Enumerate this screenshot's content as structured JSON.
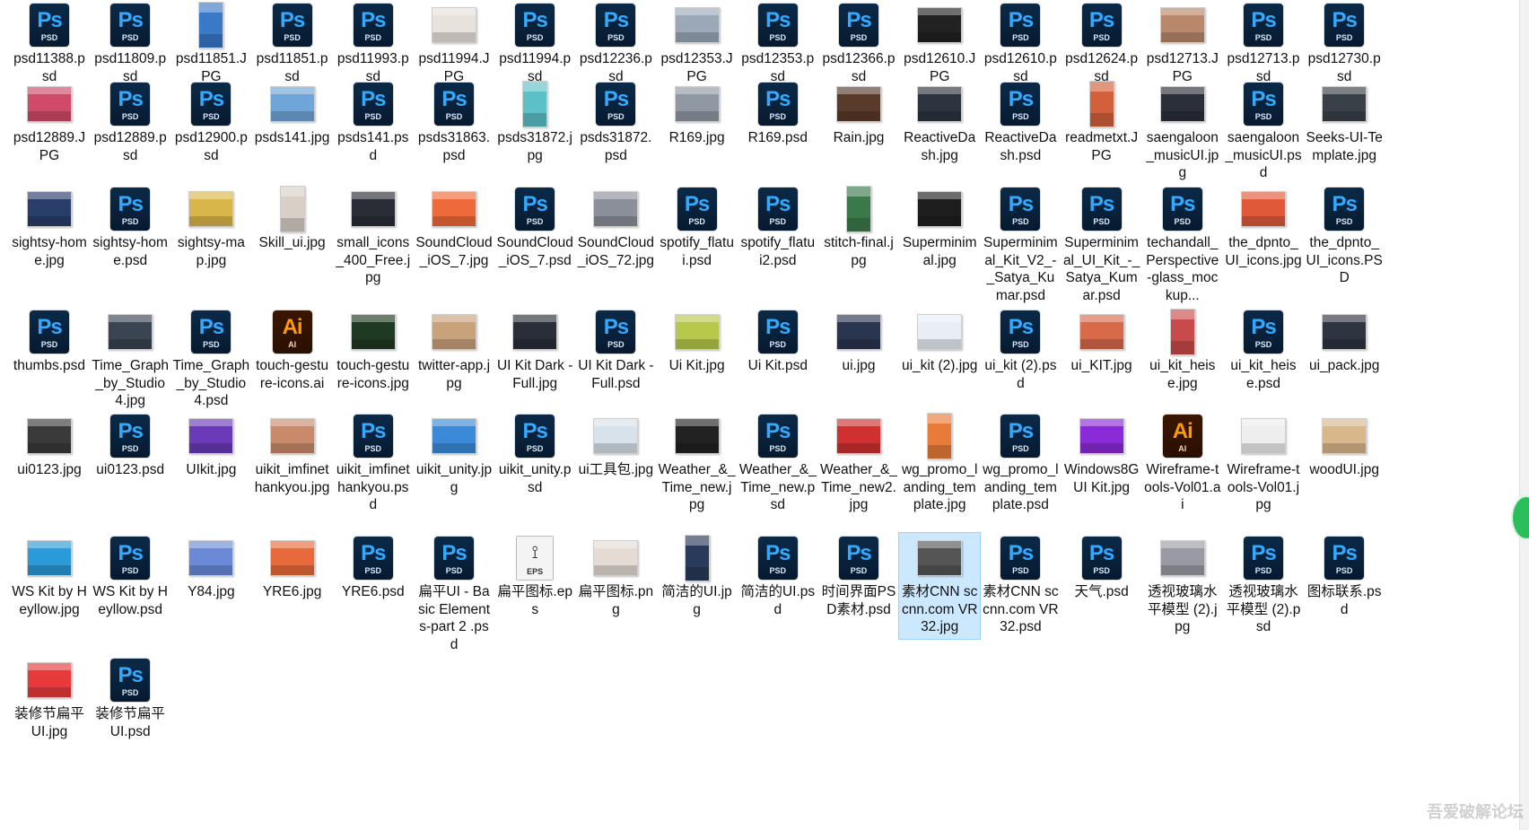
{
  "window": {
    "watermark": "吾爱破解论坛"
  },
  "files": [
    {
      "name": "psd11388.psd",
      "icon": "psd-icon"
    },
    {
      "name": "psd11809.psd",
      "icon": "psd-icon"
    },
    {
      "name": "psd11851.JPG",
      "icon": "image-thumb-icon",
      "color": "#3a78c8"
    },
    {
      "name": "psd11851.psd",
      "icon": "psd-icon"
    },
    {
      "name": "psd11993.psd",
      "icon": "psd-icon"
    },
    {
      "name": "psd11994.JPG",
      "icon": "image-thumb-icon",
      "color": "#e8e2dc"
    },
    {
      "name": "psd11994.psd",
      "icon": "psd-icon"
    },
    {
      "name": "psd12236.psd",
      "icon": "psd-icon"
    },
    {
      "name": "psd12353.JPG",
      "icon": "image-thumb-icon",
      "color": "#9aa8b8"
    },
    {
      "name": "psd12353.psd",
      "icon": "psd-icon"
    },
    {
      "name": "psd12366.psd",
      "icon": "psd-icon"
    },
    {
      "name": "psd12610.JPG",
      "icon": "image-thumb-icon",
      "color": "#222222"
    },
    {
      "name": "psd12610.psd",
      "icon": "psd-icon"
    },
    {
      "name": "psd12624.psd",
      "icon": "psd-icon"
    },
    {
      "name": "psd12713.JPG",
      "icon": "image-thumb-icon",
      "color": "#b9876a"
    },
    {
      "name": "psd12713.psd",
      "icon": "psd-icon"
    },
    {
      "name": "psd12730.psd",
      "icon": "psd-icon"
    },
    {
      "name": "psd12889.JPG",
      "icon": "image-thumb-icon",
      "color": "#d04a6a"
    },
    {
      "name": "psd12889.psd",
      "icon": "psd-icon"
    },
    {
      "name": "psd12900.psd",
      "icon": "psd-icon"
    },
    {
      "name": "psds141.jpg",
      "icon": "image-thumb-icon",
      "color": "#6fa5d8"
    },
    {
      "name": "psds141.psd",
      "icon": "psd-icon"
    },
    {
      "name": "psds31863.psd",
      "icon": "psd-icon"
    },
    {
      "name": "psds31872.jpg",
      "icon": "image-thumb-icon",
      "color": "#5cc0c8"
    },
    {
      "name": "psds31872.psd",
      "icon": "psd-icon"
    },
    {
      "name": "R169.jpg",
      "icon": "image-thumb-icon",
      "color": "#8f98a3"
    },
    {
      "name": "R169.psd",
      "icon": "psd-icon"
    },
    {
      "name": "Rain.jpg",
      "icon": "image-thumb-icon",
      "color": "#5a3a2a"
    },
    {
      "name": "ReactiveDash.jpg",
      "icon": "image-thumb-icon",
      "color": "#2c3440"
    },
    {
      "name": "ReactiveDash.psd",
      "icon": "psd-icon"
    },
    {
      "name": "readmetxt.JPG",
      "icon": "image-thumb-icon",
      "color": "#d2603a"
    },
    {
      "name": "saengaloon_musicUI.jpg",
      "icon": "image-thumb-icon",
      "color": "#2b2f3a"
    },
    {
      "name": "saengaloon_musicUI.psd",
      "icon": "psd-icon"
    },
    {
      "name": "Seeks-UI-Template.jpg",
      "icon": "image-thumb-icon",
      "color": "#3a4048"
    },
    {
      "name": "sightsy-home.jpg",
      "icon": "image-thumb-icon",
      "color": "#2a3e6a"
    },
    {
      "name": "sightsy-home.psd",
      "icon": "psd-icon"
    },
    {
      "name": "sightsy-map.jpg",
      "icon": "image-thumb-icon",
      "color": "#d9b64a"
    },
    {
      "name": "Skill_ui.jpg",
      "icon": "image-thumb-icon",
      "color": "#d8d0c6"
    },
    {
      "name": "small_icons_400_Free.jpg",
      "icon": "image-thumb-icon",
      "color": "#2a2d35"
    },
    {
      "name": "SoundCloud_iOS_7.jpg",
      "icon": "image-thumb-icon",
      "color": "#ef6a3a"
    },
    {
      "name": "SoundCloud_iOS_7.psd",
      "icon": "psd-icon"
    },
    {
      "name": "SoundCloud_iOS_72.jpg",
      "icon": "image-thumb-icon",
      "color": "#8a8f99"
    },
    {
      "name": "spotify_flatui.psd",
      "icon": "psd-icon"
    },
    {
      "name": "spotify_flatui2.psd",
      "icon": "psd-icon"
    },
    {
      "name": "stitch-final.jpg",
      "icon": "image-thumb-icon",
      "color": "#3a7a4a"
    },
    {
      "name": "Superminimal.jpg",
      "icon": "image-thumb-icon",
      "color": "#1e1e1e"
    },
    {
      "name": "Superminimal_Kit_V2_-_Satya_Kumar.psd",
      "icon": "psd-icon"
    },
    {
      "name": "Superminimal_UI_Kit_-_Satya_Kumar.psd",
      "icon": "psd-icon"
    },
    {
      "name": "techandall_Perspective-glass_mockup...",
      "icon": "psd-icon"
    },
    {
      "name": "the_dpnto_UI_icons.jpg",
      "icon": "image-thumb-icon",
      "color": "#e05a3a"
    },
    {
      "name": "the_dpnto_UI_icons.PSD",
      "icon": "psd-icon"
    },
    {
      "name": "thumbs.psd",
      "icon": "psd-icon"
    },
    {
      "name": "Time_Graph_by_Studio4.jpg",
      "icon": "image-thumb-icon",
      "color": "#3a4452"
    },
    {
      "name": "Time_Graph_by_Studio4.psd",
      "icon": "psd-icon"
    },
    {
      "name": "touch-gesture-icons.ai",
      "icon": "ai-icon"
    },
    {
      "name": "touch-gesture-icons.jpg",
      "icon": "image-thumb-icon",
      "color": "#1f3a22"
    },
    {
      "name": "twitter-app.jpg",
      "icon": "image-thumb-icon",
      "color": "#c8a27a"
    },
    {
      "name": "UI Kit Dark - Full.jpg",
      "icon": "image-thumb-icon",
      "color": "#2a2e38"
    },
    {
      "name": "UI Kit Dark - Full.psd",
      "icon": "psd-icon"
    },
    {
      "name": "Ui Kit.jpg",
      "icon": "image-thumb-icon",
      "color": "#b8c84a"
    },
    {
      "name": "Ui Kit.psd",
      "icon": "psd-icon"
    },
    {
      "name": "ui.jpg",
      "icon": "image-thumb-icon",
      "color": "#2a3550"
    },
    {
      "name": "ui_kit (2).jpg",
      "icon": "image-thumb-icon",
      "color": "#e8eef4"
    },
    {
      "name": "ui_kit (2).psd",
      "icon": "psd-icon"
    },
    {
      "name": "ui_KIT.jpg",
      "icon": "image-thumb-icon",
      "color": "#d86a4a"
    },
    {
      "name": "ui_kit_heise.jpg",
      "icon": "image-thumb-icon",
      "color": "#c84a4a"
    },
    {
      "name": "ui_kit_heise.psd",
      "icon": "psd-icon"
    },
    {
      "name": "ui_pack.jpg",
      "icon": "image-thumb-icon",
      "color": "#2e3440"
    },
    {
      "name": "ui0123.jpg",
      "icon": "image-thumb-icon",
      "color": "#3a3a3a"
    },
    {
      "name": "ui0123.psd",
      "icon": "psd-icon"
    },
    {
      "name": "UIkit.jpg",
      "icon": "image-thumb-icon",
      "color": "#6a3ab8"
    },
    {
      "name": "uikit_imfinethankyou.jpg",
      "icon": "image-thumb-icon",
      "color": "#c88a6a"
    },
    {
      "name": "uikit_imfinethankyou.psd",
      "icon": "psd-icon"
    },
    {
      "name": "uikit_unity.jpg",
      "icon": "image-thumb-icon",
      "color": "#3a8ad8"
    },
    {
      "name": "uikit_unity.psd",
      "icon": "psd-icon"
    },
    {
      "name": "ui工具包.jpg",
      "icon": "image-thumb-icon",
      "color": "#d8e2ea"
    },
    {
      "name": "Weather_&_Time_new.jpg",
      "icon": "image-thumb-icon",
      "color": "#222222"
    },
    {
      "name": "Weather_&_Time_new.psd",
      "icon": "psd-icon"
    },
    {
      "name": "Weather_&_Time_new2.jpg",
      "icon": "image-thumb-icon",
      "color": "#d03030"
    },
    {
      "name": "wg_promo_landing_template.jpg",
      "icon": "image-thumb-icon",
      "color": "#e87a3a"
    },
    {
      "name": "wg_promo_landing_template.psd",
      "icon": "psd-icon"
    },
    {
      "name": "Windows8GUI Kit.jpg",
      "icon": "image-thumb-icon",
      "color": "#8a2ad8"
    },
    {
      "name": "Wireframe-tools-Vol01.ai",
      "icon": "ai-icon"
    },
    {
      "name": "Wireframe-tools-Vol01.jpg",
      "icon": "image-thumb-icon",
      "color": "#eeeeee"
    },
    {
      "name": "woodUI.jpg",
      "icon": "image-thumb-icon",
      "color": "#d8b88a"
    },
    {
      "name": "WS Kit by Heyllow.jpg",
      "icon": "image-thumb-icon",
      "color": "#2a9ad8"
    },
    {
      "name": "WS Kit by Heyllow.psd",
      "icon": "psd-icon"
    },
    {
      "name": "Y84.jpg",
      "icon": "image-thumb-icon",
      "color": "#6a8ad8"
    },
    {
      "name": "YRE6.jpg",
      "icon": "image-thumb-icon",
      "color": "#e86a3a"
    },
    {
      "name": "YRE6.psd",
      "icon": "psd-icon"
    },
    {
      "name": "扁平UI - Basic Elements-part 2 .psd",
      "icon": "psd-icon"
    },
    {
      "name": "扁平图标.eps",
      "icon": "eps-icon"
    },
    {
      "name": "扁平图标.png",
      "icon": "image-thumb-icon",
      "color": "#e4dcd4"
    },
    {
      "name": "简洁的UI.jpg",
      "icon": "image-thumb-icon",
      "color": "#2a3a5a"
    },
    {
      "name": "简洁的UI.psd",
      "icon": "psd-icon"
    },
    {
      "name": "时间界面PSD素材.psd",
      "icon": "psd-icon"
    },
    {
      "name": "素材CNN sccnn.com VR32.jpg",
      "icon": "image-thumb-icon",
      "color": "#555555",
      "selected": true
    },
    {
      "name": "素材CNN sccnn.com VR32.psd",
      "icon": "psd-icon"
    },
    {
      "name": "天气.psd",
      "icon": "psd-icon"
    },
    {
      "name": "透视玻璃水平模型 (2).jpg",
      "icon": "image-thumb-icon",
      "color": "#9a9aa4"
    },
    {
      "name": "透视玻璃水平模型 (2).psd",
      "icon": "psd-icon"
    },
    {
      "name": "图标联系.psd",
      "icon": "psd-icon"
    },
    {
      "name": "装修节扁平UI.jpg",
      "icon": "image-thumb-icon",
      "color": "#e83a3a"
    },
    {
      "name": "装修节扁平UI.psd",
      "icon": "psd-icon"
    }
  ],
  "icon_text": {
    "ps_big": "Ps",
    "ps_ext": "PSD",
    "ai_big": "Ai",
    "ai_ext": "AI",
    "eps_big": "⟟",
    "eps_ext": "EPS"
  }
}
